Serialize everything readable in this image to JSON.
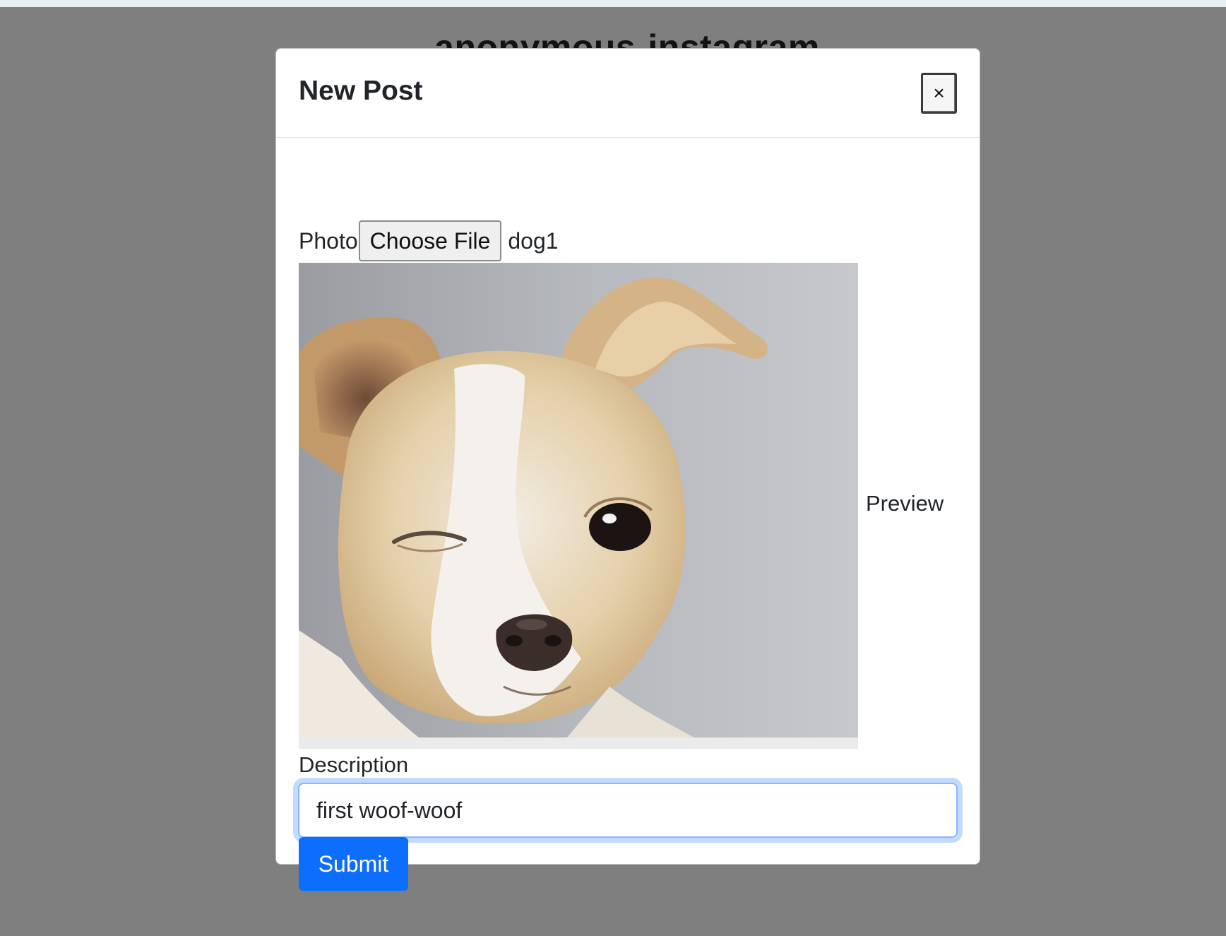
{
  "page": {
    "title": "anonymous-instagram"
  },
  "modal": {
    "title": "New Post",
    "close_label": "×"
  },
  "form": {
    "photo_label": "Photo",
    "file_button_label": "Choose File",
    "file_name": "dog1",
    "preview_label": "Preview",
    "preview_alt": "dog1",
    "description_label": "Description",
    "description_value": "first woof-woof",
    "submit_label": "Submit"
  },
  "colors": {
    "primary": "#0d6efd",
    "focus_ring": "#86b7fe",
    "backdrop": "#808080"
  }
}
